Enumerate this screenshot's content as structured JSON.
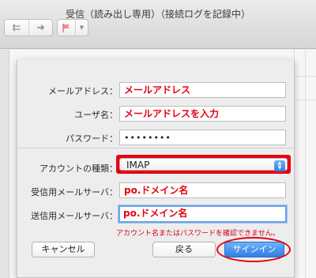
{
  "window": {
    "title": "受信（読み出し専用）（接続ログを記録中）",
    "toolbar": {
      "reply_all_icon": "reply-all-icon",
      "forward_icon": "forward-icon",
      "flag_icon": "flag-icon",
      "flag_menu_icon": "chevron-down-icon"
    }
  },
  "dialog": {
    "fields": {
      "email_label": "メールアドレス：",
      "email_value": "メールアドレス",
      "username_label": "ユーザ名：",
      "username_value": "メールアドレスを入力",
      "password_label": "パスワード：",
      "password_value": "••••••••",
      "account_type_label": "アカウントの種類：",
      "account_type_value": "IMAP",
      "incoming_server_label": "受信用メールサーバ：",
      "incoming_server_value": "po.ドメイン名",
      "outgoing_server_label": "送信用メールサーバ：",
      "outgoing_server_value": "po.ドメイン名"
    },
    "error_message": "アカウント名またはパスワードを確認できません。",
    "buttons": {
      "cancel": "キャンセル",
      "back": "戻る",
      "sign_in": "サインイン"
    },
    "annotation_color": "#e60012",
    "accent_color": "#2f7fe4"
  }
}
